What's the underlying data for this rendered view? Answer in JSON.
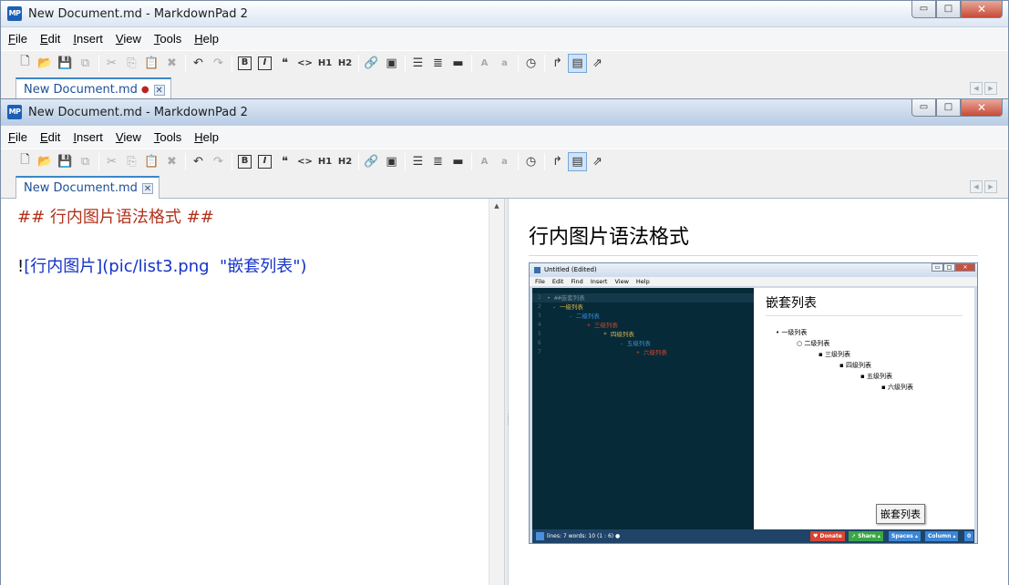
{
  "app": {
    "title": "New Document.md - MarkdownPad 2",
    "icon_text": "MP"
  },
  "window_controls": {
    "minimize": "▭",
    "maximize": "□",
    "close": "✕"
  },
  "menu": [
    {
      "label": "File",
      "accel": "F",
      "rest": "ile"
    },
    {
      "label": "Edit",
      "accel": "E",
      "rest": "dit"
    },
    {
      "label": "Insert",
      "accel": "I",
      "rest": "nsert"
    },
    {
      "label": "View",
      "accel": "V",
      "rest": "iew"
    },
    {
      "label": "Tools",
      "accel": "T",
      "rest": "ools"
    },
    {
      "label": "Help",
      "accel": "H",
      "rest": "elp"
    }
  ],
  "toolbar": {
    "heading1": "H1",
    "heading2": "H2",
    "bold": "B",
    "italic": "I",
    "quote": "❝",
    "code": "<>",
    "font_large": "A",
    "font_small": "a"
  },
  "back_tab": {
    "label": "New Document.md",
    "modified_marker": "●",
    "close": "✕"
  },
  "front_tab": {
    "label": "New Document.md",
    "close": "✕"
  },
  "tab_nav": {
    "prev": "◀",
    "next": "▶"
  },
  "editor": {
    "line1": "## 行内图片语法格式 ##",
    "line2_bang": "!",
    "line2_rest": "[行内图片](pic/list3.png  \"嵌套列表\")"
  },
  "preview": {
    "heading": "行内图片语法格式",
    "image_tooltip": "嵌套列表",
    "embedded": {
      "title": "Untitled (Edited)",
      "menu": [
        "File",
        "Edit",
        "Find",
        "Insert",
        "View",
        "Help"
      ],
      "code_lines": [
        {
          "num": "1",
          "text": "• ##嵌套列表"
        },
        {
          "num": "2",
          "text": "- 一级列表"
        },
        {
          "num": "3",
          "text": "- 二级列表"
        },
        {
          "num": "4",
          "text": "+ 三级列表"
        },
        {
          "num": "5",
          "text": "* 四级列表"
        },
        {
          "num": "6",
          "text": "- 五级列表"
        },
        {
          "num": "7",
          "text": "+ 六级列表"
        }
      ],
      "heading": "嵌套列表",
      "list": [
        "一级列表",
        "二级列表",
        "三级列表",
        "四级列表",
        "五级列表",
        "六级列表"
      ],
      "status_left": "lines: 7   words: 10   (1 : 6)   ●",
      "donate": "♥ Donate",
      "share": "➚ Share ▴",
      "spaces": "Spaces ▴",
      "column": "Column ▴",
      "zero": "0"
    }
  },
  "colors": {
    "heading_markup": "#b2321c",
    "link_markup": "#1432c8",
    "tab_text": "#1e4f96"
  }
}
